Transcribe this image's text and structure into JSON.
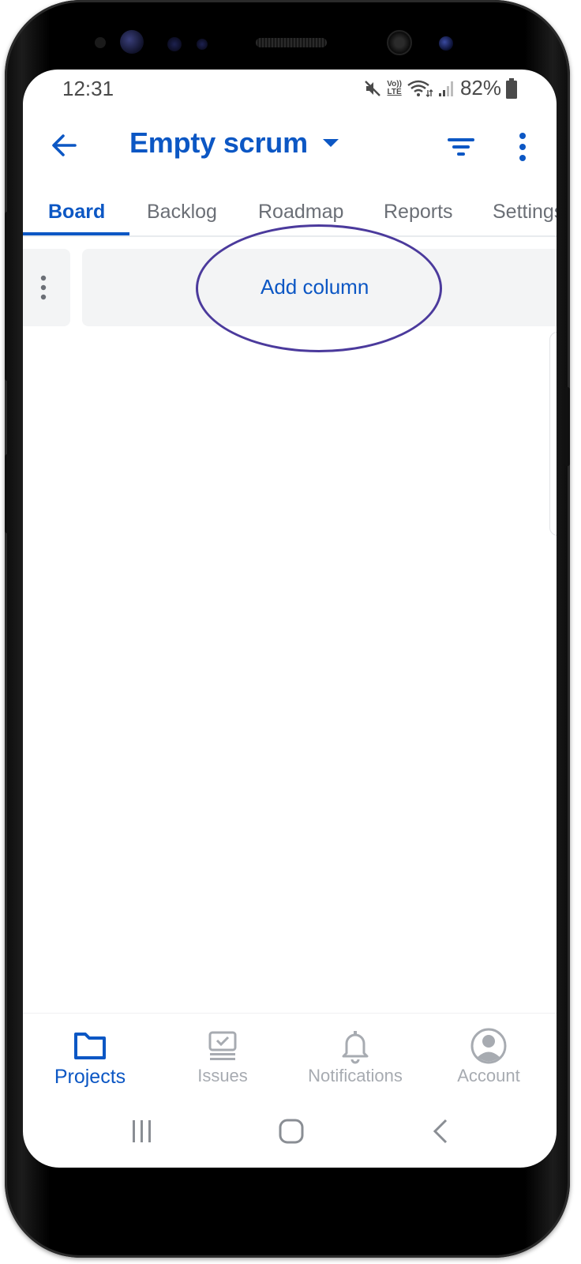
{
  "status_bar": {
    "time": "12:31",
    "volte_top": "Vo))",
    "volte_bottom": "LTE",
    "battery": "82%"
  },
  "app_bar": {
    "title": "Empty scrum",
    "accent": "#0c57c4"
  },
  "tabs": [
    {
      "label": "Board",
      "active": true
    },
    {
      "label": "Backlog",
      "active": false
    },
    {
      "label": "Roadmap",
      "active": false
    },
    {
      "label": "Reports",
      "active": false
    },
    {
      "label": "Settings",
      "active": false
    }
  ],
  "board": {
    "add_column_label": "Add column",
    "highlight_color": "#4b3a9c"
  },
  "bottom_nav": [
    {
      "label": "Projects",
      "icon": "folder-icon",
      "active": true
    },
    {
      "label": "Issues",
      "icon": "issues-icon",
      "active": false
    },
    {
      "label": "Notifications",
      "icon": "bell-icon",
      "active": false
    },
    {
      "label": "Account",
      "icon": "account-icon",
      "active": false
    }
  ],
  "system_nav": [
    "recent-apps-icon",
    "home-icon",
    "back-icon"
  ]
}
